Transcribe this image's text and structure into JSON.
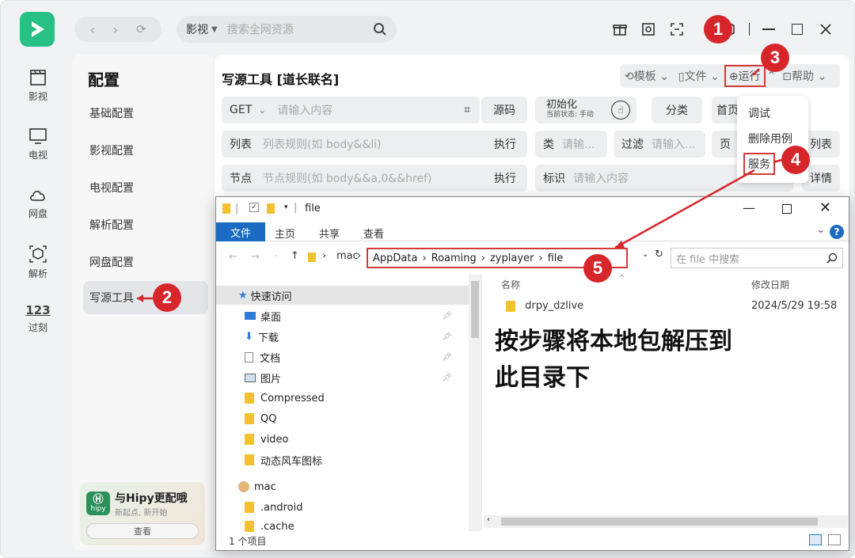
{
  "nav": {
    "items": [
      {
        "label": "影视",
        "icon": "clapperboard-icon"
      },
      {
        "label": "电视",
        "icon": "tv-icon"
      },
      {
        "label": "网盘",
        "icon": "cloud-icon"
      },
      {
        "label": "解析",
        "icon": "cube-icon"
      },
      {
        "label": "过刻",
        "icon": "numbers-icon"
      }
    ]
  },
  "topbar": {
    "search_scope": "影视",
    "search_placeholder": "搜索全网资源"
  },
  "config": {
    "title": "配置",
    "items": [
      "基础配置",
      "影视配置",
      "电视配置",
      "解析配置",
      "网盘配置",
      "写源工具"
    ],
    "active": "写源工具"
  },
  "promo": {
    "title": "与Hipy更配哦",
    "subtitle": "新起点, 新开始",
    "button": "查看",
    "logo_text": "hipy"
  },
  "main": {
    "title": "写源工具 [道长联名]",
    "toolbar": {
      "template": "模板",
      "file": "文件",
      "run": "运行",
      "help": "帮助"
    },
    "row1": {
      "method": "GET",
      "placeholder": "请输入内容",
      "source_btn": "源码",
      "init_label": "初始化",
      "init_status": "当前状态: 手动",
      "category_btn": "分类",
      "home_btn": "首页"
    },
    "row2": {
      "label": "列表",
      "placeholder": "列表规则(如 body&&li)",
      "exec": "执行",
      "cat_label": "类",
      "cat_ph": "请输...",
      "filter_label": "过滤",
      "filter_ph": "请输入...",
      "page_label": "页",
      "list_btn": "列表"
    },
    "row3": {
      "label": "节点",
      "placeholder": "节点规则(如 body&&a,0&&href)",
      "exec": "执行",
      "id_label": "标识",
      "id_ph": "请输入内容",
      "detail_btn": "详情"
    },
    "dropdown": [
      "调试",
      "删除用例",
      "服务"
    ]
  },
  "explorer": {
    "title": "file",
    "ribbon": {
      "file": "文件",
      "home": "主页",
      "share": "共享",
      "view": "查看"
    },
    "address": {
      "root": "mac",
      "parts": [
        "AppData",
        "Roaming",
        "zyplayer",
        "file"
      ]
    },
    "search_placeholder": "在 file 中搜索",
    "nav": {
      "quick_access": "快速访问",
      "items": [
        "桌面",
        "下载",
        "文档",
        "图片",
        "Compressed",
        "QQ",
        "video",
        "动态风车图标"
      ],
      "mac_label": "mac",
      "mac_items": [
        ".android",
        ".cache"
      ]
    },
    "columns": {
      "name": "名称",
      "modified": "修改日期"
    },
    "files": [
      {
        "name": "drpy_dzlive",
        "modified": "2024/5/29 19:58"
      }
    ],
    "status": "1 个项目"
  },
  "annotation": {
    "note_line1": "按步骤将本地包解压到",
    "note_line2": "此目录下",
    "badges": [
      "1",
      "2",
      "3",
      "4",
      "5"
    ],
    "color": "#d7262b"
  }
}
